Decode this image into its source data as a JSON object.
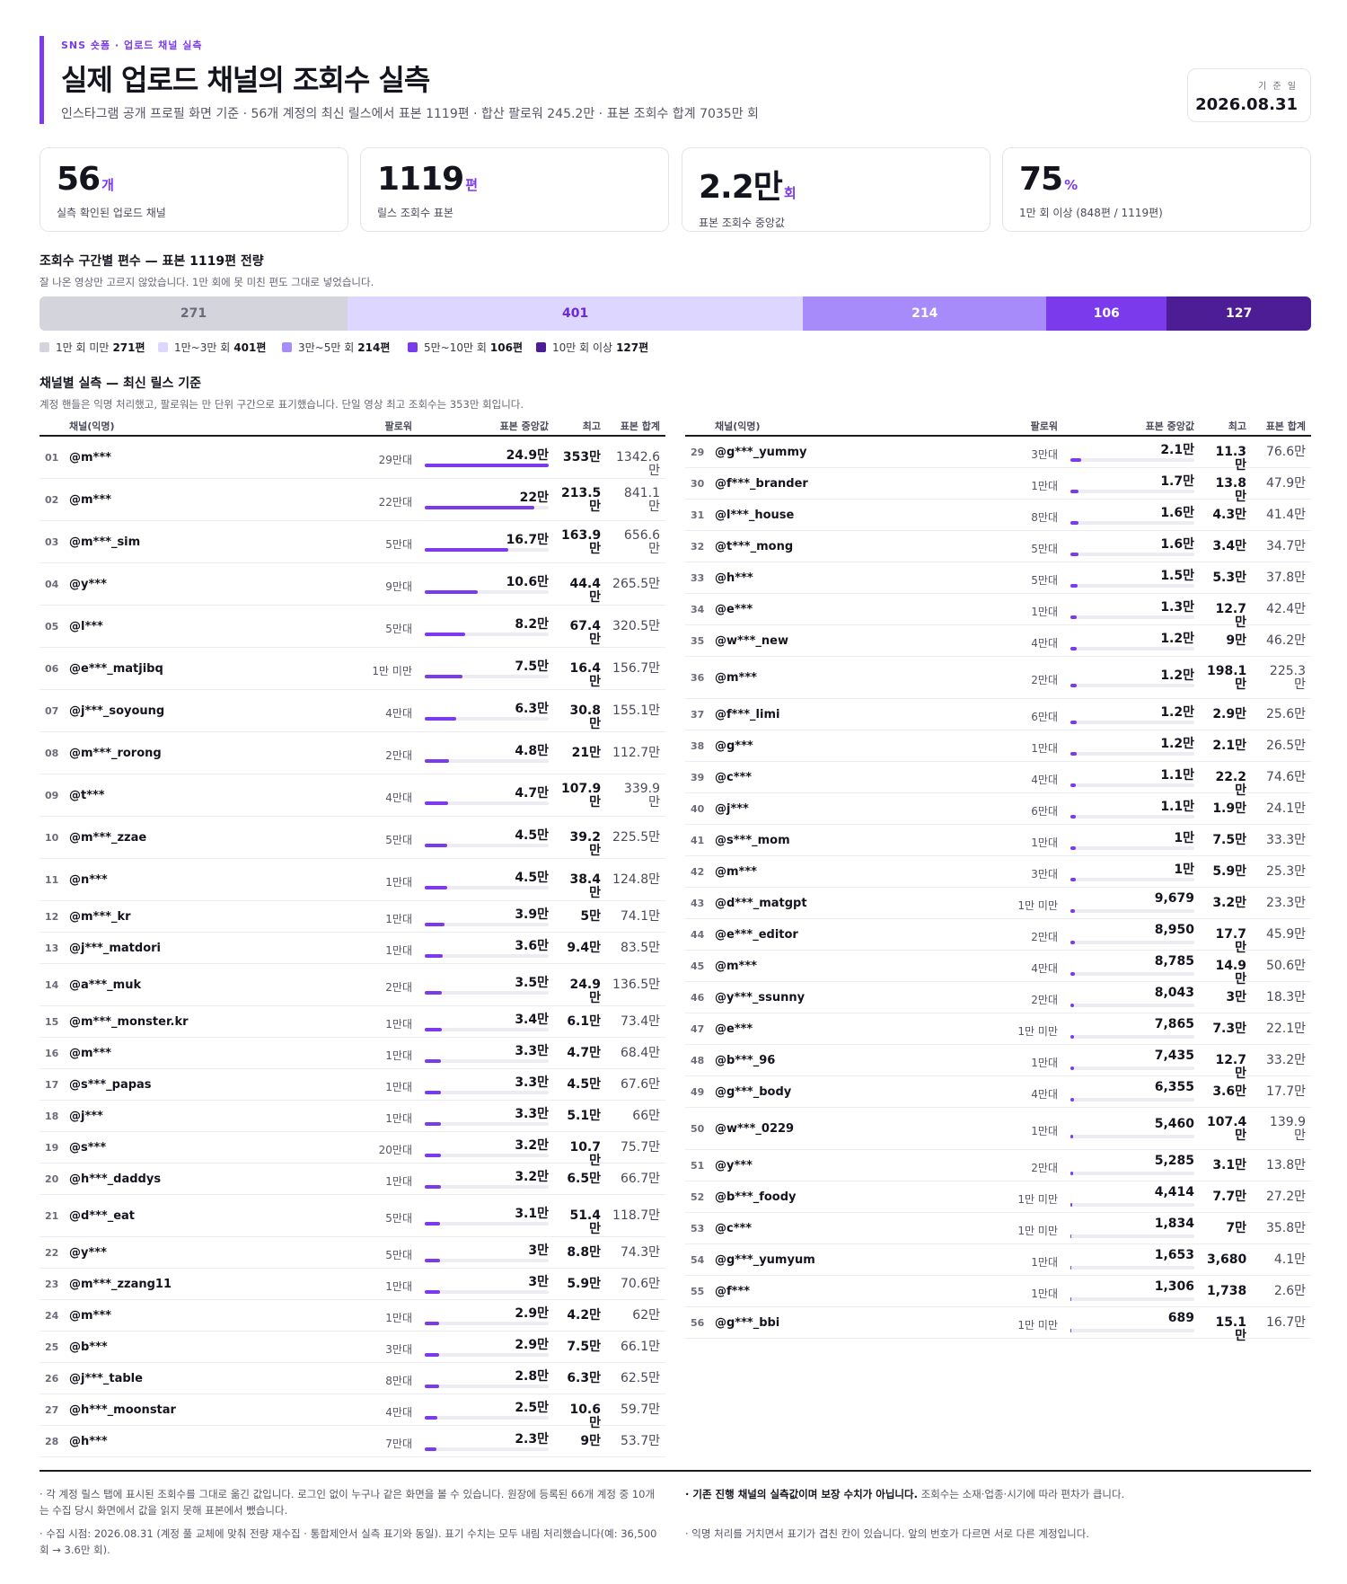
{
  "header": {
    "kicker": "SNS 숏폼 · 업로드 채널 실측",
    "title": "실제 업로드 채널의 조회수 실측",
    "subtitle": "인스타그램 공개 프로필 화면 기준 · 56개 계정의 최신 릴스에서 표본 1119편 · 합산 팔로워 245.2만 · 표본 조회수 합계 7035만 회",
    "date_label": "기 준 일",
    "date_value": "2026.08.31"
  },
  "kpis": [
    {
      "value": "56",
      "unit": "개",
      "label": "실측 확인된 업로드 채널"
    },
    {
      "value": "1119",
      "unit": "편",
      "label": "릴스 조회수 표본"
    },
    {
      "value": "2.2만",
      "unit": "회",
      "label": "표본 조회수 중앙값"
    },
    {
      "value": "75",
      "unit": "%",
      "label": "1만 회 이상 (848편 / 1119편)"
    }
  ],
  "distribution": {
    "title": "조회수 구간별 편수 — 표본 1119편 전량",
    "subtitle": "잘 나온 영상만 고르지 않았습니다. 1만 회에 못 미친 편도 그대로 넣었습니다.",
    "total": 1119,
    "buckets": [
      {
        "label": "1만 회 미만",
        "count": 271,
        "count_label": "271편",
        "color": "#d4d4dc",
        "text_color": "#6b6b7a"
      },
      {
        "label": "1만~3만 회",
        "count": 401,
        "count_label": "401편",
        "color": "#ddd6fe",
        "text_color": "#6d28d9"
      },
      {
        "label": "3만~5만 회",
        "count": 214,
        "count_label": "214편",
        "color": "#a78bfa",
        "text_color": "#ffffff"
      },
      {
        "label": "5만~10만 회",
        "count": 106,
        "count_label": "106편",
        "color": "#7c3aed",
        "text_color": "#ffffff"
      },
      {
        "label": "10만 회 이상",
        "count": 127,
        "count_label": "127편",
        "color": "#4c1d95",
        "text_color": "#ffffff"
      }
    ]
  },
  "channels": {
    "title": "채널별 실측 — 최신 릴스 기준",
    "subtitle": "계정 핸들은 익명 처리했고, 팔로워는 만 단위 구간으로 표기했습니다. 단일 영상 최고 조회수는 353만 회입니다.",
    "headers": {
      "name": "채널(익명)",
      "followers": "팔로워",
      "median": "표본 중앙값",
      "max": "최고",
      "sum": "표본 합계"
    },
    "rows": [
      {
        "n": "01",
        "name": "@m***",
        "followers": "29만대",
        "median": "24.9만",
        "median_value": 249000,
        "max": "353만",
        "sum": "1342.6만"
      },
      {
        "n": "02",
        "name": "@m***",
        "followers": "22만대",
        "median": "22만",
        "median_value": 220000,
        "max": "213.5만",
        "sum": "841.1만"
      },
      {
        "n": "03",
        "name": "@m***_sim",
        "followers": "5만대",
        "median": "16.7만",
        "median_value": 167000,
        "max": "163.9만",
        "sum": "656.6만"
      },
      {
        "n": "04",
        "name": "@y***",
        "followers": "9만대",
        "median": "10.6만",
        "median_value": 106000,
        "max": "44.4만",
        "sum": "265.5만"
      },
      {
        "n": "05",
        "name": "@l***",
        "followers": "5만대",
        "median": "8.2만",
        "median_value": 82000,
        "max": "67.4만",
        "sum": "320.5만"
      },
      {
        "n": "06",
        "name": "@e***_matjibq",
        "followers": "1만 미만",
        "median": "7.5만",
        "median_value": 75000,
        "max": "16.4만",
        "sum": "156.7만"
      },
      {
        "n": "07",
        "name": "@j***_soyoung",
        "followers": "4만대",
        "median": "6.3만",
        "median_value": 63000,
        "max": "30.8만",
        "sum": "155.1만"
      },
      {
        "n": "08",
        "name": "@m***_rorong",
        "followers": "2만대",
        "median": "4.8만",
        "median_value": 48000,
        "max": "21만",
        "sum": "112.7만"
      },
      {
        "n": "09",
        "name": "@t***",
        "followers": "4만대",
        "median": "4.7만",
        "median_value": 47000,
        "max": "107.9만",
        "sum": "339.9만"
      },
      {
        "n": "10",
        "name": "@m***_zzae",
        "followers": "5만대",
        "median": "4.5만",
        "median_value": 45000,
        "max": "39.2만",
        "sum": "225.5만"
      },
      {
        "n": "11",
        "name": "@n***",
        "followers": "1만대",
        "median": "4.5만",
        "median_value": 45000,
        "max": "38.4만",
        "sum": "124.8만"
      },
      {
        "n": "12",
        "name": "@m***_kr",
        "followers": "1만대",
        "median": "3.9만",
        "median_value": 39000,
        "max": "5만",
        "sum": "74.1만"
      },
      {
        "n": "13",
        "name": "@j***_matdori",
        "followers": "1만대",
        "median": "3.6만",
        "median_value": 36000,
        "max": "9.4만",
        "sum": "83.5만"
      },
      {
        "n": "14",
        "name": "@a***_muk",
        "followers": "2만대",
        "median": "3.5만",
        "median_value": 35000,
        "max": "24.9만",
        "sum": "136.5만"
      },
      {
        "n": "15",
        "name": "@m***_monster.kr",
        "followers": "1만대",
        "median": "3.4만",
        "median_value": 34000,
        "max": "6.1만",
        "sum": "73.4만"
      },
      {
        "n": "16",
        "name": "@m***",
        "followers": "1만대",
        "median": "3.3만",
        "median_value": 33000,
        "max": "4.7만",
        "sum": "68.4만"
      },
      {
        "n": "17",
        "name": "@s***_papas",
        "followers": "1만대",
        "median": "3.3만",
        "median_value": 33000,
        "max": "4.5만",
        "sum": "67.6만"
      },
      {
        "n": "18",
        "name": "@j***",
        "followers": "1만대",
        "median": "3.3만",
        "median_value": 33000,
        "max": "5.1만",
        "sum": "66만"
      },
      {
        "n": "19",
        "name": "@s***",
        "followers": "20만대",
        "median": "3.2만",
        "median_value": 32000,
        "max": "10.7만",
        "sum": "75.7만"
      },
      {
        "n": "20",
        "name": "@h***_daddys",
        "followers": "1만대",
        "median": "3.2만",
        "median_value": 32000,
        "max": "6.5만",
        "sum": "66.7만"
      },
      {
        "n": "21",
        "name": "@d***_eat",
        "followers": "5만대",
        "median": "3.1만",
        "median_value": 31000,
        "max": "51.4만",
        "sum": "118.7만"
      },
      {
        "n": "22",
        "name": "@y***",
        "followers": "5만대",
        "median": "3만",
        "median_value": 30000,
        "max": "8.8만",
        "sum": "74.3만"
      },
      {
        "n": "23",
        "name": "@m***_zzang11",
        "followers": "1만대",
        "median": "3만",
        "median_value": 30000,
        "max": "5.9만",
        "sum": "70.6만"
      },
      {
        "n": "24",
        "name": "@m***",
        "followers": "1만대",
        "median": "2.9만",
        "median_value": 29000,
        "max": "4.2만",
        "sum": "62만"
      },
      {
        "n": "25",
        "name": "@b***",
        "followers": "3만대",
        "median": "2.9만",
        "median_value": 29000,
        "max": "7.5만",
        "sum": "66.1만"
      },
      {
        "n": "26",
        "name": "@j***_table",
        "followers": "8만대",
        "median": "2.8만",
        "median_value": 28000,
        "max": "6.3만",
        "sum": "62.5만"
      },
      {
        "n": "27",
        "name": "@h***_moonstar",
        "followers": "4만대",
        "median": "2.5만",
        "median_value": 25000,
        "max": "10.6만",
        "sum": "59.7만"
      },
      {
        "n": "28",
        "name": "@h***",
        "followers": "7만대",
        "median": "2.3만",
        "median_value": 23000,
        "max": "9만",
        "sum": "53.7만"
      },
      {
        "n": "29",
        "name": "@g***_yummy",
        "followers": "3만대",
        "median": "2.1만",
        "median_value": 21000,
        "max": "11.3만",
        "sum": "76.6만"
      },
      {
        "n": "30",
        "name": "@f***_brander",
        "followers": "1만대",
        "median": "1.7만",
        "median_value": 17000,
        "max": "13.8만",
        "sum": "47.9만"
      },
      {
        "n": "31",
        "name": "@l***_house",
        "followers": "8만대",
        "median": "1.6만",
        "median_value": 16000,
        "max": "4.3만",
        "sum": "41.4만"
      },
      {
        "n": "32",
        "name": "@t***_mong",
        "followers": "5만대",
        "median": "1.6만",
        "median_value": 16000,
        "max": "3.4만",
        "sum": "34.7만"
      },
      {
        "n": "33",
        "name": "@h***",
        "followers": "5만대",
        "median": "1.5만",
        "median_value": 15000,
        "max": "5.3만",
        "sum": "37.8만"
      },
      {
        "n": "34",
        "name": "@e***",
        "followers": "1만대",
        "median": "1.3만",
        "median_value": 13000,
        "max": "12.7만",
        "sum": "42.4만"
      },
      {
        "n": "35",
        "name": "@w***_new",
        "followers": "4만대",
        "median": "1.2만",
        "median_value": 12000,
        "max": "9만",
        "sum": "46.2만"
      },
      {
        "n": "36",
        "name": "@m***",
        "followers": "2만대",
        "median": "1.2만",
        "median_value": 12000,
        "max": "198.1만",
        "sum": "225.3만"
      },
      {
        "n": "37",
        "name": "@f***_limi",
        "followers": "6만대",
        "median": "1.2만",
        "median_value": 12000,
        "max": "2.9만",
        "sum": "25.6만"
      },
      {
        "n": "38",
        "name": "@g***",
        "followers": "1만대",
        "median": "1.2만",
        "median_value": 12000,
        "max": "2.1만",
        "sum": "26.5만"
      },
      {
        "n": "39",
        "name": "@c***",
        "followers": "4만대",
        "median": "1.1만",
        "median_value": 11000,
        "max": "22.2만",
        "sum": "74.6만"
      },
      {
        "n": "40",
        "name": "@j***",
        "followers": "6만대",
        "median": "1.1만",
        "median_value": 11000,
        "max": "1.9만",
        "sum": "24.1만"
      },
      {
        "n": "41",
        "name": "@s***_mom",
        "followers": "1만대",
        "median": "1만",
        "median_value": 10000,
        "max": "7.5만",
        "sum": "33.3만"
      },
      {
        "n": "42",
        "name": "@m***",
        "followers": "3만대",
        "median": "1만",
        "median_value": 10000,
        "max": "5.9만",
        "sum": "25.3만"
      },
      {
        "n": "43",
        "name": "@d***_matgpt",
        "followers": "1만 미만",
        "median": "9,679",
        "median_value": 9679,
        "max": "3.2만",
        "sum": "23.3만"
      },
      {
        "n": "44",
        "name": "@e***_editor",
        "followers": "2만대",
        "median": "8,950",
        "median_value": 8950,
        "max": "17.7만",
        "sum": "45.9만"
      },
      {
        "n": "45",
        "name": "@m***",
        "followers": "4만대",
        "median": "8,785",
        "median_value": 8785,
        "max": "14.9만",
        "sum": "50.6만"
      },
      {
        "n": "46",
        "name": "@y***_ssunny",
        "followers": "2만대",
        "median": "8,043",
        "median_value": 8043,
        "max": "3만",
        "sum": "18.3만"
      },
      {
        "n": "47",
        "name": "@e***",
        "followers": "1만 미만",
        "median": "7,865",
        "median_value": 7865,
        "max": "7.3만",
        "sum": "22.1만"
      },
      {
        "n": "48",
        "name": "@b***_96",
        "followers": "1만대",
        "median": "7,435",
        "median_value": 7435,
        "max": "12.7만",
        "sum": "33.2만"
      },
      {
        "n": "49",
        "name": "@g***_body",
        "followers": "4만대",
        "median": "6,355",
        "median_value": 6355,
        "max": "3.6만",
        "sum": "17.7만"
      },
      {
        "n": "50",
        "name": "@w***_0229",
        "followers": "1만대",
        "median": "5,460",
        "median_value": 5460,
        "max": "107.4만",
        "sum": "139.9만"
      },
      {
        "n": "51",
        "name": "@y***",
        "followers": "2만대",
        "median": "5,285",
        "median_value": 5285,
        "max": "3.1만",
        "sum": "13.8만"
      },
      {
        "n": "52",
        "name": "@b***_foody",
        "followers": "1만 미만",
        "median": "4,414",
        "median_value": 4414,
        "max": "7.7만",
        "sum": "27.2만"
      },
      {
        "n": "53",
        "name": "@c***",
        "followers": "1만 미만",
        "median": "1,834",
        "median_value": 1834,
        "max": "7만",
        "sum": "35.8만"
      },
      {
        "n": "54",
        "name": "@g***_yumyum",
        "followers": "1만대",
        "median": "1,653",
        "median_value": 1653,
        "max": "3,680",
        "sum": "4.1만"
      },
      {
        "n": "55",
        "name": "@f***",
        "followers": "1만대",
        "median": "1,306",
        "median_value": 1306,
        "max": "1,738",
        "sum": "2.6만"
      },
      {
        "n": "56",
        "name": "@g***_bbi",
        "followers": "1만 미만",
        "median": "689",
        "median_value": 689,
        "max": "15.1만",
        "sum": "16.7만"
      }
    ]
  },
  "footer": {
    "note1": "· 각 계정 릴스 탭에 표시된 조회수를 그대로 옮긴 값입니다. 로그인 없이 누구나 같은 화면을 볼 수 있습니다. 원장에 등록된 66개 계정 중 10개는 수집 당시 화면에서 값을 읽지 못해 표본에서 뺐습니다.",
    "note2": "· 수집 시점: 2026.08.31 (계정 풀 교체에 맞춰 전량 재수집 · 통합제안서 실측 표기와 동일). 표기 수치는 모두 내림 처리했습니다(예: 36,500회 → 3.6만 회).",
    "note3_bold": "· 기존 진행 채널의 실측값이며 보장 수치가 아닙니다.",
    "note3_rest": " 조회수는 소재·업종·시기에 따라 편차가 큽니다.",
    "note4": "· 익명 처리를 거치면서 표기가 겹친 칸이 있습니다. 앞의 번호가 다르면 서로 다른 계정입니다."
  }
}
